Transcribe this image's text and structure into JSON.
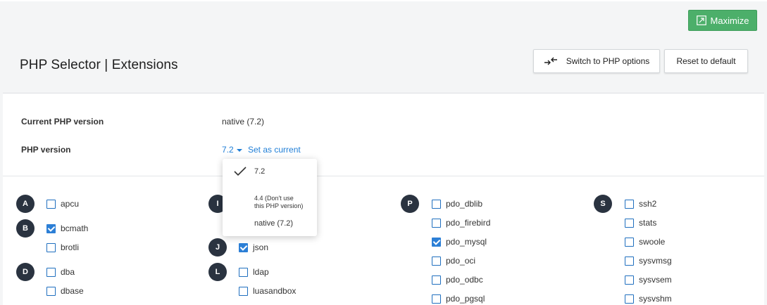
{
  "toolbar": {
    "maximize_label": "Maximize"
  },
  "header": {
    "title": "PHP Selector | Extensions",
    "switch_label": "Switch to PHP options",
    "reset_label": "Reset to default"
  },
  "info": {
    "current_label": "Current PHP version",
    "current_value": "native (7.2)",
    "version_label": "PHP version",
    "version_value": "7.2",
    "set_current_label": "Set as current"
  },
  "dropdown": {
    "options": [
      "7.2",
      "4.4 (Don't use",
      "this PHP version)",
      "native (7.2)"
    ],
    "selected": "7.2"
  },
  "letters": [
    "A",
    "B",
    "D",
    "I",
    "J",
    "L",
    "P",
    "S"
  ],
  "extensions": [
    {
      "name": "apcu",
      "checked": false
    },
    {
      "name": "bcmath",
      "checked": true
    },
    {
      "name": "brotli",
      "checked": false
    },
    {
      "name": "dba",
      "checked": false
    },
    {
      "name": "dbase",
      "checked": false
    },
    {
      "name": "json",
      "checked": true
    },
    {
      "name": "ldap",
      "checked": false
    },
    {
      "name": "luasandbox",
      "checked": false
    },
    {
      "name": "pdo_dblib",
      "checked": false
    },
    {
      "name": "pdo_firebird",
      "checked": false
    },
    {
      "name": "pdo_mysql",
      "checked": true
    },
    {
      "name": "pdo_oci",
      "checked": false
    },
    {
      "name": "pdo_odbc",
      "checked": false
    },
    {
      "name": "pdo_pgsql",
      "checked": false
    },
    {
      "name": "ssh2",
      "checked": false
    },
    {
      "name": "stats",
      "checked": false
    },
    {
      "name": "swoole",
      "checked": false
    },
    {
      "name": "sysvmsg",
      "checked": false
    },
    {
      "name": "sysvsem",
      "checked": false
    },
    {
      "name": "sysvshm",
      "checked": false
    }
  ],
  "colors": {
    "accent": "#1f7ed6",
    "maximize": "#4caf6a",
    "letter_badge": "#2a3340"
  }
}
